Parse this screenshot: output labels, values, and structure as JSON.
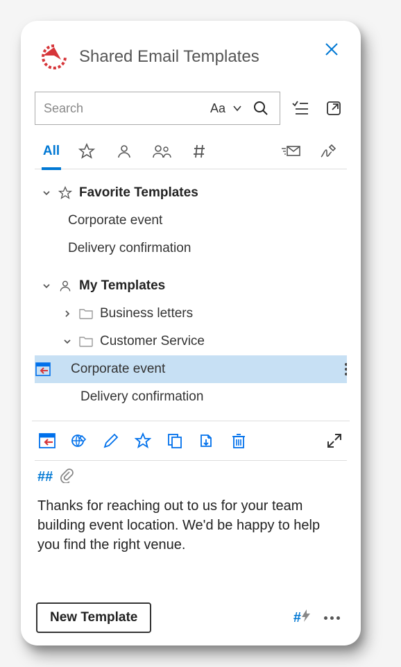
{
  "header": {
    "title": "Shared Email Templates"
  },
  "search": {
    "placeholder": "Search",
    "case_label": "Aa"
  },
  "filters": {
    "all_label": "All",
    "active": "all"
  },
  "tree": {
    "favorites": {
      "label": "Favorite Templates",
      "items": [
        "Corporate event",
        "Delivery confirmation"
      ]
    },
    "my": {
      "label": "My Templates",
      "folders": [
        {
          "name": "Business letters",
          "expanded": false
        },
        {
          "name": "Customer Service",
          "expanded": true,
          "items": [
            "Corporate event",
            "Delivery confirmation"
          ],
          "selected_index": 0
        }
      ]
    }
  },
  "preview": {
    "hash_badge": "##",
    "body": "Thanks for reaching out to us for your team building event location. We'd be happy to help you find the right venue."
  },
  "footer": {
    "new_button": "New Template",
    "hash_shortcut_symbol": "#"
  }
}
